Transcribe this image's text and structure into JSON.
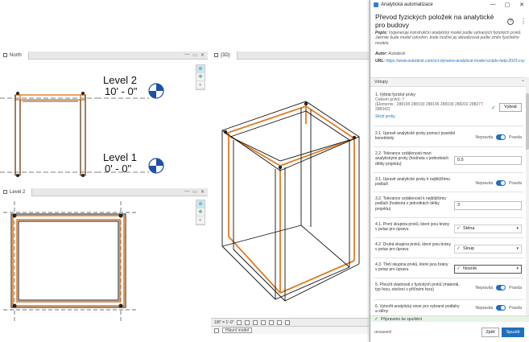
{
  "views": {
    "north": {
      "tab_label": "North"
    },
    "level2": {
      "tab_label": "Level 2"
    },
    "threed": {
      "tab_label": "{3D}"
    },
    "levels": [
      {
        "name": "Level 2",
        "elevation": "10' - 0\""
      },
      {
        "name": "Level 1",
        "elevation": "0' - 0\""
      }
    ],
    "footer_scale": "1/8\" = 1'-0\"",
    "footer_detail": "Hlavní model"
  },
  "panel": {
    "window_title": "Analytická automatizace",
    "title": "Převod fyzických položek na analytické pro budovy",
    "popis_label": "Popis:",
    "popis_text": "Vygeneruje konstrukční analytický model podle vybraných fyzických prvků. Jakmile bude model vytvořen, bude možné jej aktualizovat podle změn fyzického modelu.",
    "autor_label": "Autor:",
    "autor_text": "Autodesk",
    "url_label": "URL:",
    "url_text": "https://www.autodesk.com/sct-dynamo-analytical-model-scripts-help-2023-csy",
    "section_label": "Vstupy",
    "toggle_off": "Nepravda",
    "toggle_on": "Pravda",
    "rows": [
      {
        "label": "1. Vybrat fyzické prvky",
        "sub1": "Celkem prvků: 7",
        "sub2": "(Elements : 288199 288193 288196 288199 288202 288277 288342)",
        "link": "Skrýt prvky",
        "button": "Vybrat"
      },
      {
        "label": "2.1. Upravit analytické prvky pomocí pravidel konektivity",
        "toggle": true
      },
      {
        "label": "2.2. Tolerance vzdálenosti mezi analytickými prvky (hodnota v jednotkách délky projektu)",
        "value": "0.5"
      },
      {
        "label": "3.1. Upravit analytické prvky k nejbližšímu podlaží",
        "toggle": true
      },
      {
        "label": "3.2. Tolerance vzdálenosti k nejbližšímu podlaží (hodnota v jednotkách délky projektu)",
        "value": "3"
      },
      {
        "label": "4.1. První skupina prvků, které jsou brány v potaz pro úpravu",
        "select": "Stěna"
      },
      {
        "label": "4.2. Druhá skupina prvků, které jsou brány v potaz pro úpravu",
        "select": "Sloup"
      },
      {
        "label": "4.3. Třetí skupina prvků, které jsou brány v potaz pro úpravu",
        "select": "Nosník"
      },
      {
        "label": "5. Převzít vlastnosti z fyzických prvků (materiál, typ řezu, otočení v příčném řezu)",
        "toggle": true
      },
      {
        "label": "6. Vytvořit analytický otvor pro vybrané podlahy a stěny",
        "toggle": true
      }
    ],
    "status": "Připraveno ke spuštění",
    "unsaved": "unsaved",
    "save_button": "Zpět",
    "run_button": "Spustit",
    "accent": "#1f6fbf"
  }
}
